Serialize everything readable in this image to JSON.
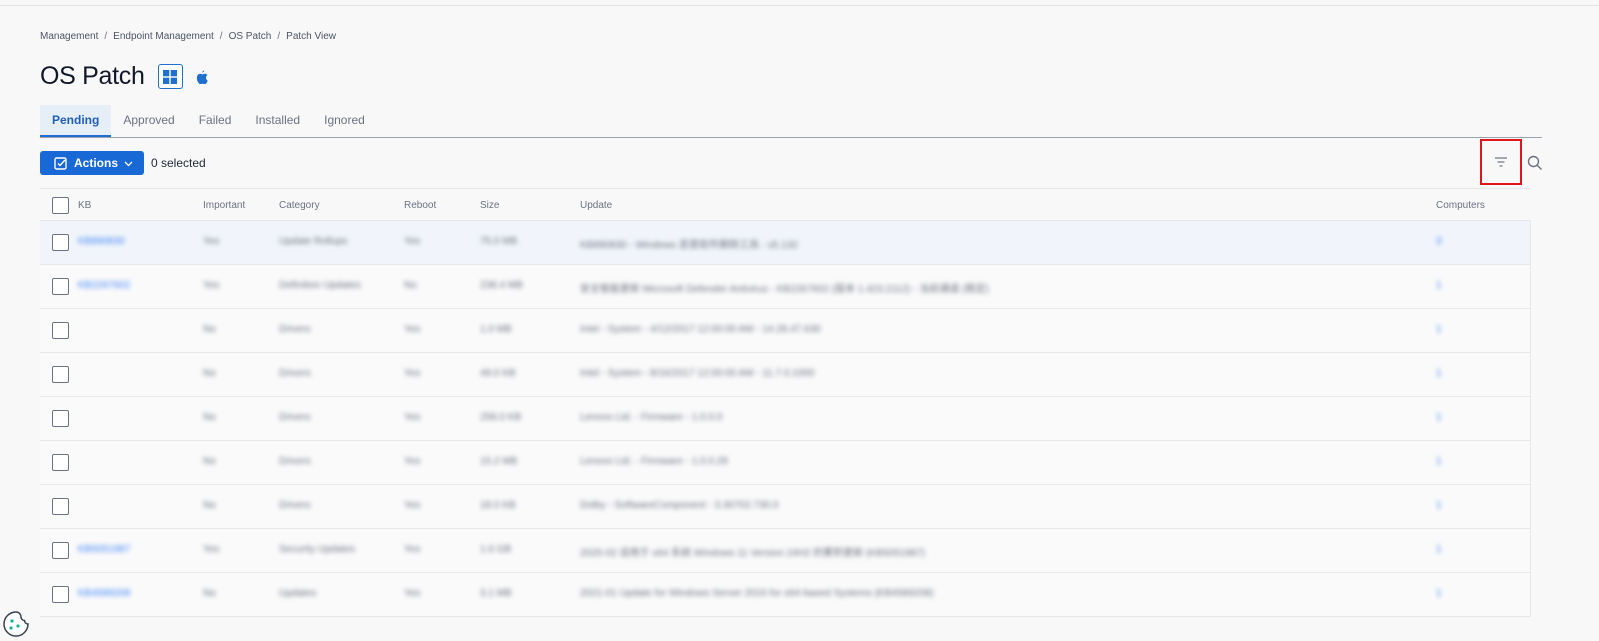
{
  "breadcrumb": [
    "Management",
    "Endpoint Management",
    "OS Patch",
    "Patch View"
  ],
  "page": {
    "title": "OS Patch"
  },
  "tabs": [
    {
      "label": "Pending",
      "active": true
    },
    {
      "label": "Approved"
    },
    {
      "label": "Failed"
    },
    {
      "label": "Installed"
    },
    {
      "label": "Ignored"
    }
  ],
  "toolbar": {
    "actions_label": "Actions",
    "selected_text": "0 selected"
  },
  "table": {
    "columns": [
      "KB",
      "Important",
      "Category",
      "Reboot",
      "Size",
      "Update",
      "Computers"
    ],
    "rows": [
      {
        "kb": "KB890830",
        "important": "Yes",
        "category": "Update Rollups",
        "reboot": "Yes",
        "size": "75.0 MB",
        "update": "KB890830 - Windows 恶意软件删除工具 - x5.132",
        "computers": "3"
      },
      {
        "kb": "KB2267602",
        "important": "Yes",
        "category": "Definition Updates",
        "reboot": "No",
        "size": "238.4 MB",
        "update": "安全智能更新 Microsoft Defender Antivirus - KB2267602 (版本 1.423.2112) - 当前通道 (稳定)",
        "computers": "1"
      },
      {
        "kb": "",
        "important": "No",
        "category": "Drivers",
        "reboot": "Yes",
        "size": "1.0 MB",
        "update": "Intel - System - 4/12/2017 12:00:00 AM - 14.28.47.630",
        "computers": "1"
      },
      {
        "kb": "",
        "important": "No",
        "category": "Drivers",
        "reboot": "Yes",
        "size": "49.0 KB",
        "update": "Intel - System - 8/16/2017 12:00:00 AM - 11.7.0.1000",
        "computers": "1"
      },
      {
        "kb": "",
        "important": "No",
        "category": "Drivers",
        "reboot": "Yes",
        "size": "258.0 KB",
        "update": "Lenovo Ltd. - Firmware - 1.0.0.0",
        "computers": "1"
      },
      {
        "kb": "",
        "important": "No",
        "category": "Drivers",
        "reboot": "Yes",
        "size": "15.2 MB",
        "update": "Lenovo Ltd. - Firmware - 1.0.0.29",
        "computers": "1"
      },
      {
        "kb": "",
        "important": "No",
        "category": "Drivers",
        "reboot": "Yes",
        "size": "18.0 KB",
        "update": "Dolby - SoftwareComponent - 3.30702.730.0",
        "computers": "1"
      },
      {
        "kb": "KB5051987",
        "important": "Yes",
        "category": "Security Updates",
        "reboot": "Yes",
        "size": "1.6 GB",
        "update": "2025-02 适用于 x64 系统 Windows 11 Version 24H2 的累积更新 (KB5051987)",
        "computers": "1"
      },
      {
        "kb": "KB4589208",
        "important": "No",
        "category": "Updates",
        "reboot": "Yes",
        "size": "3.1 MB",
        "update": "2021-01 Update for Windows Server 2016 for x64-based Systems (KB4589208)",
        "computers": "1"
      }
    ]
  },
  "icons": {
    "windows": "windows-icon",
    "apple": "apple-icon",
    "actions": "checkbox-icon",
    "filter": "filter-icon",
    "search": "search-icon",
    "cookie": "cookie-icon"
  },
  "colors": {
    "primary": "#1868d6",
    "highlight_border": "#e0161d",
    "link": "#3b82f6"
  }
}
